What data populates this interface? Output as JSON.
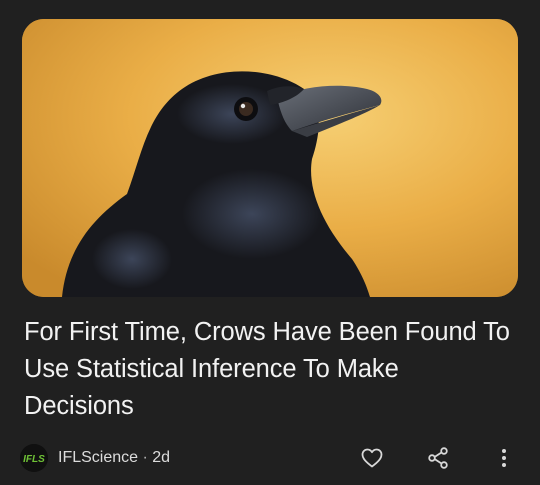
{
  "article": {
    "headline": "For First Time, Crows Have Been Found To Use Statistical Inference To Make Decisions",
    "image_subject": "crow",
    "background_color": "#e9ad45"
  },
  "footer": {
    "source_logo_text": "IFLS",
    "source_name": "IFLScience",
    "separator": "·",
    "age": "2d",
    "actions": [
      {
        "name": "like",
        "icon": "heart-icon"
      },
      {
        "name": "share",
        "icon": "share-icon"
      },
      {
        "name": "more",
        "icon": "more-vertical-icon"
      }
    ]
  },
  "colors": {
    "card_background": "#202020",
    "text_primary": "#f2f2f2",
    "text_secondary": "#dcdcdc",
    "logo_green": "#6fc236"
  }
}
